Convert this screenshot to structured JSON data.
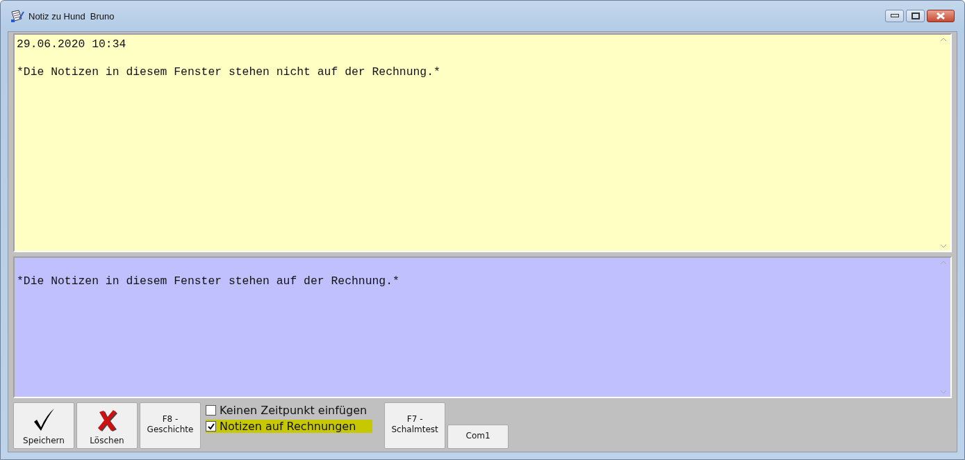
{
  "window": {
    "title": "Notiz zu Hund  Bruno"
  },
  "fields": [
    {
      "kind": "internal",
      "text": "29.06.2020 10:34\n\n*Die Notizen in diesem Fenster stehen nicht auf der Rechnung.*"
    },
    {
      "kind": "invoice",
      "text": "\n*Die Notizen in diesem Fenster stehen auf der Rechnung.*"
    }
  ],
  "buttons": [
    {
      "kind": "save",
      "label": "Speichern"
    },
    {
      "kind": "delete",
      "label": "Löschen"
    },
    {
      "kind": "text",
      "label": "F8 -\nGeschichte"
    }
  ],
  "checkboxes": [
    {
      "label": "Keinen Zeitpunkt einfügen",
      "checked": false,
      "highlighted": false
    },
    {
      "label": "Notizen auf Rechnungen",
      "checked": true,
      "highlighted": true
    }
  ],
  "extra_buttons": [
    {
      "label": "F7 -\nSchalmtest",
      "kind": "tall"
    },
    {
      "label": "Com1",
      "kind": "short"
    }
  ]
}
